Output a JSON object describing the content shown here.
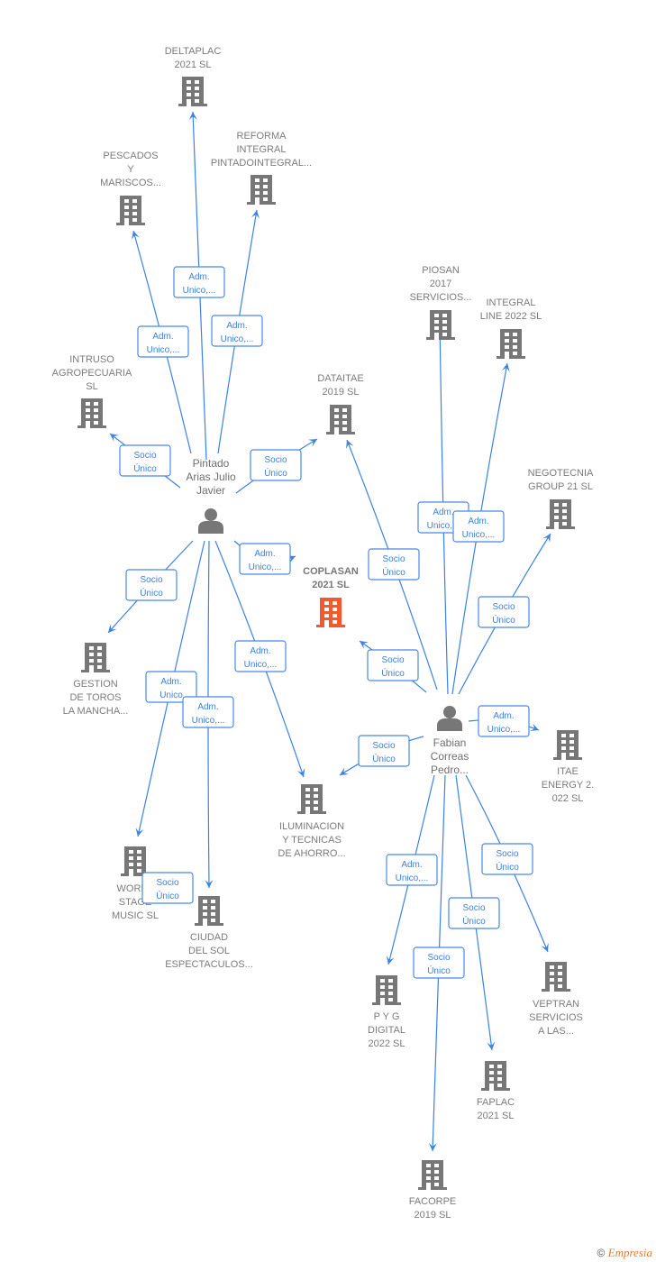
{
  "colors": {
    "edge": "#3b82e4",
    "node": "#777777",
    "focus": "#f5582a",
    "label_text": "#3d7fe0"
  },
  "nodes": [
    {
      "id": "deltaplac",
      "type": "company",
      "lines": [
        "DELTAPLAC",
        "2021  SL"
      ]
    },
    {
      "id": "pescados",
      "type": "company",
      "lines": [
        "PESCADOS",
        "Y",
        "MARISCOS..."
      ]
    },
    {
      "id": "reforma",
      "type": "company",
      "lines": [
        "REFORMA",
        "INTEGRAL",
        "PINTADOINTEGRAL..."
      ]
    },
    {
      "id": "intruso",
      "type": "company",
      "lines": [
        "INTRUSO",
        "AGROPECUARIA",
        "SL"
      ]
    },
    {
      "id": "dataitae",
      "type": "company",
      "lines": [
        "DATAITAE",
        "2019  SL"
      ]
    },
    {
      "id": "coplasan",
      "type": "company",
      "focus": true,
      "lines": [
        "COPLASAN",
        "2021  SL"
      ]
    },
    {
      "id": "pintado",
      "type": "person",
      "lines": [
        "Pintado",
        "Arias Julio",
        "Javier"
      ]
    },
    {
      "id": "gestion",
      "type": "company",
      "lines": [
        "GESTION",
        "DE TOROS",
        "LA MANCHA..."
      ]
    },
    {
      "id": "world",
      "type": "company",
      "lines": [
        "WORLD",
        "STAGE",
        "MUSIC  SL"
      ]
    },
    {
      "id": "ciudad",
      "type": "company",
      "lines": [
        "CIUDAD",
        "DEL SOL",
        "ESPECTACULOS..."
      ]
    },
    {
      "id": "iluminacion",
      "type": "company",
      "lines": [
        "ILUMINACION",
        "Y TECNICAS",
        "DE AHORRO..."
      ]
    },
    {
      "id": "piosan",
      "type": "company",
      "lines": [
        "PIOSAN",
        "2017",
        "SERVICIOS..."
      ]
    },
    {
      "id": "integral",
      "type": "company",
      "lines": [
        "INTEGRAL",
        "LINE 2022  SL"
      ]
    },
    {
      "id": "negotecnia",
      "type": "company",
      "lines": [
        "NEGOTECNIA",
        "GROUP 21 SL"
      ]
    },
    {
      "id": "fabian",
      "type": "person",
      "lines": [
        "Fabian",
        "Correas",
        "Pedro..."
      ]
    },
    {
      "id": "itae",
      "type": "company",
      "lines": [
        "ITAE",
        "ENERGY 2.",
        "022  SL"
      ]
    },
    {
      "id": "pyg",
      "type": "company",
      "lines": [
        "P Y G",
        "DIGITAL",
        "2022  SL"
      ]
    },
    {
      "id": "veptran",
      "type": "company",
      "lines": [
        "VEPTRAN",
        "SERVICIOS",
        "A LAS..."
      ]
    },
    {
      "id": "faplac",
      "type": "company",
      "lines": [
        "FAPLAC",
        "2021  SL"
      ]
    },
    {
      "id": "facorpe",
      "type": "company",
      "lines": [
        "FACORPE",
        "2019  SL"
      ]
    }
  ],
  "edges": [
    {
      "from": "pintado",
      "to": "deltaplac",
      "label": [
        "Adm.",
        "Unico,..."
      ]
    },
    {
      "from": "pintado",
      "to": "pescados",
      "label": [
        "Adm.",
        "Unico,..."
      ]
    },
    {
      "from": "pintado",
      "to": "reforma",
      "label": [
        "Adm.",
        "Unico,..."
      ]
    },
    {
      "from": "pintado",
      "to": "intruso",
      "label": [
        "Socio",
        "Único"
      ]
    },
    {
      "from": "pintado",
      "to": "dataitae",
      "label": [
        "Socio",
        "Único"
      ]
    },
    {
      "from": "pintado",
      "to": "coplasan",
      "label": [
        "Adm.",
        "Unico,..."
      ]
    },
    {
      "from": "pintado",
      "to": "gestion",
      "label": [
        "Socio",
        "Único"
      ]
    },
    {
      "from": "pintado",
      "to": "world",
      "label": [
        "Adm.",
        "Unico"
      ]
    },
    {
      "from": "pintado",
      "to": "ciudad",
      "label": [
        "Adm.",
        "Unico,..."
      ]
    },
    {
      "from": "pintado",
      "to": "iluminacion",
      "label": [
        "Adm.",
        "Unico,..."
      ]
    },
    {
      "from": "world",
      "to": "world",
      "label": [
        "Socio",
        "Único"
      ]
    },
    {
      "from": "fabian",
      "to": "dataitae",
      "label": [
        "Socio",
        "Único"
      ]
    },
    {
      "from": "fabian",
      "to": "coplasan",
      "label": [
        "Socio",
        "Único"
      ]
    },
    {
      "from": "fabian",
      "to": "piosan",
      "label": [
        "Adm.",
        "Unico,..."
      ]
    },
    {
      "from": "fabian",
      "to": "integral",
      "label": [
        "Adm.",
        "Unico,..."
      ]
    },
    {
      "from": "fabian",
      "to": "negotecnia",
      "label": [
        "Socio",
        "Único"
      ]
    },
    {
      "from": "fabian",
      "to": "itae",
      "label": [
        "Adm.",
        "Unico,..."
      ]
    },
    {
      "from": "fabian",
      "to": "iluminacion",
      "label": [
        "Socio",
        "Único"
      ]
    },
    {
      "from": "fabian",
      "to": "pyg",
      "label": [
        "Adm.",
        "Unico,..."
      ]
    },
    {
      "from": "fabian",
      "to": "facorpe",
      "label": [
        "Socio",
        "Único"
      ]
    },
    {
      "from": "fabian",
      "to": "faplac",
      "label": [
        "Socio",
        "Único"
      ]
    },
    {
      "from": "fabian",
      "to": "veptran",
      "label": [
        "Socio",
        "Único"
      ]
    }
  ],
  "footer": {
    "copyright": "©",
    "brand": "Empresia"
  }
}
